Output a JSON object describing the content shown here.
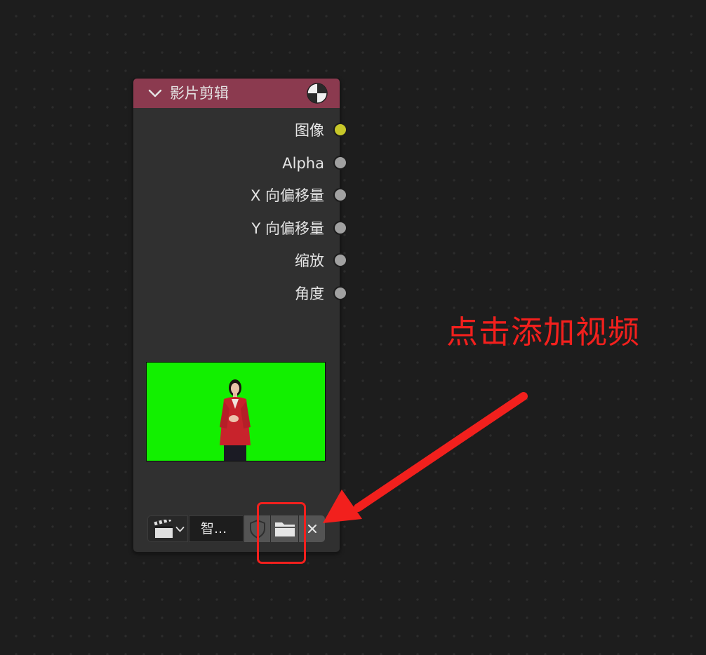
{
  "node": {
    "title": "影片剪辑",
    "header_color": "#8b3a4f",
    "header_icon": "movie-clip-pie-icon",
    "collapse_icon": "chevron-down-icon"
  },
  "outputs": [
    {
      "label": "图像",
      "socket_color": "#c7c729"
    },
    {
      "label": "Alpha",
      "socket_color": "#a1a1a1"
    },
    {
      "label": "X 向偏移量",
      "socket_color": "#a1a1a1"
    },
    {
      "label": "Y 向偏移量",
      "socket_color": "#a1a1a1"
    },
    {
      "label": "缩放",
      "socket_color": "#a1a1a1"
    },
    {
      "label": "角度",
      "socket_color": "#a1a1a1"
    }
  ],
  "preview": {
    "background": "#12f000",
    "subject": "person-in-red-jacket"
  },
  "toolbar": {
    "clip_type_icon": "clapperboard-icon",
    "clip_name": "智...",
    "fake_user_icon": "shield-icon",
    "open_icon": "folder-icon",
    "unlink_icon": "close-icon"
  },
  "annotation": {
    "text": "点击添加视频",
    "color": "#f2201d"
  }
}
